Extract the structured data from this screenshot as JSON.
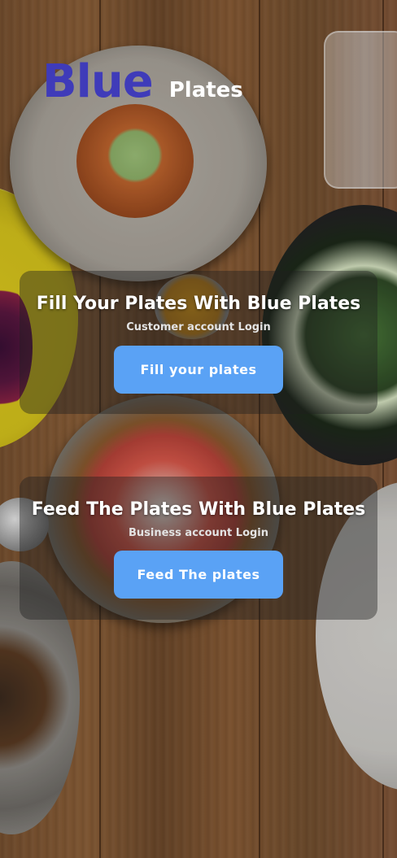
{
  "logo": {
    "blue_text": "Blue",
    "plates_text": "Plates",
    "blue_color": "#3f3bb9"
  },
  "customer": {
    "title": "Fill Your Plates With Blue Plates",
    "subtitle": "Customer account Login",
    "button_label": "Fill your plates"
  },
  "business": {
    "title": "Feed The Plates With Blue Plates",
    "subtitle": "Business account Login",
    "button_label": "Feed The plates"
  },
  "colors": {
    "button": "#5aa2f5",
    "panel_overlay": "rgba(30,30,30,0.42)"
  },
  "background": {
    "description_icon": "food-table-photo"
  }
}
